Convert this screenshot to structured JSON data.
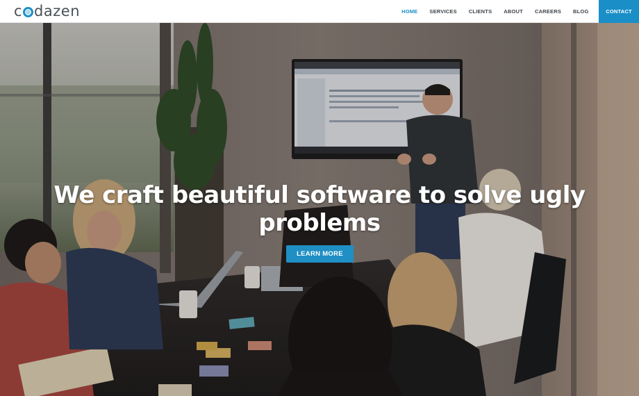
{
  "brand": {
    "logo_text_left": "c",
    "logo_text_right": "dazen",
    "accent_color": "#1a8fc7"
  },
  "nav": {
    "items": [
      {
        "label": "HOME",
        "active": true
      },
      {
        "label": "SERVICES",
        "active": false
      },
      {
        "label": "CLIENTS",
        "active": false
      },
      {
        "label": "ABOUT",
        "active": false
      },
      {
        "label": "CAREERS",
        "active": false
      },
      {
        "label": "BLOG",
        "active": false
      }
    ],
    "contact_label": "CONTACT"
  },
  "hero": {
    "headline_line1": "We craft beautiful software to solve ugly",
    "headline_line2": "problems",
    "cta_label": "LEARN MORE",
    "background": "meeting-room-photo"
  }
}
